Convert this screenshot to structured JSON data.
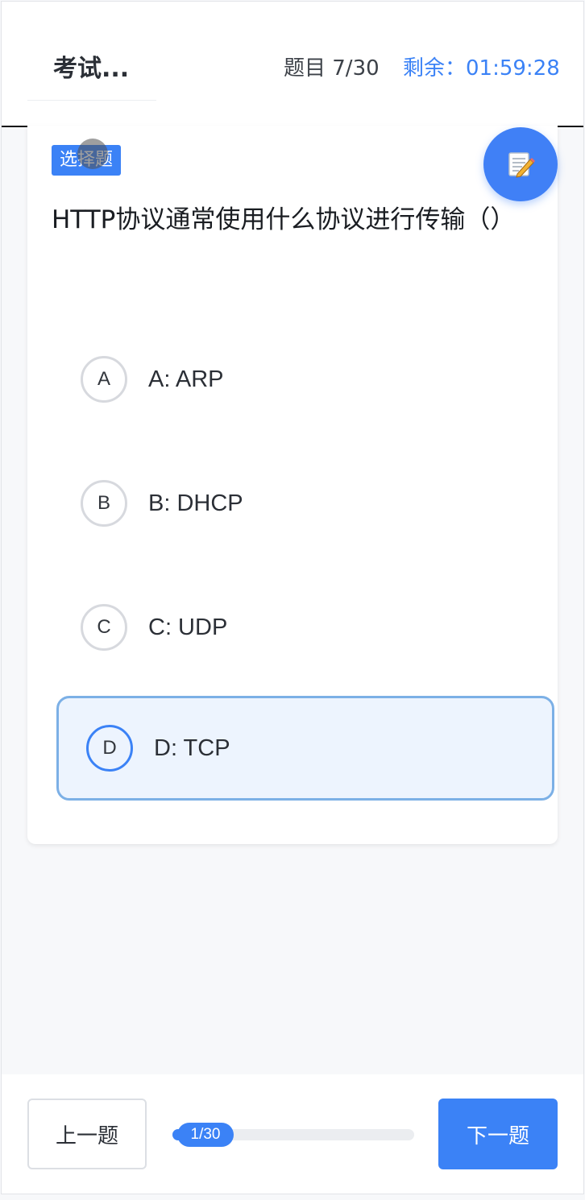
{
  "header": {
    "title": "考试...",
    "progress_text": "题目 7/30",
    "timer_text": "剩余：01:59:28"
  },
  "question": {
    "type_badge": "选择题",
    "text": "HTTP协议通常使用什么协议进行传输（）",
    "options": [
      {
        "letter": "A",
        "label": "A: ARP",
        "selected": false
      },
      {
        "letter": "B",
        "label": "B: DHCP",
        "selected": false
      },
      {
        "letter": "C",
        "label": "C: UDP",
        "selected": false
      },
      {
        "letter": "D",
        "label": "D: TCP",
        "selected": true
      }
    ]
  },
  "fab": {
    "icon": "notepad-pencil-icon"
  },
  "footer": {
    "prev_label": "上一题",
    "next_label": "下一题",
    "progress_pill": "1/30",
    "progress_fraction": 0.0333
  },
  "colors": {
    "accent": "#3b82f6",
    "selected_bg": "#edf4fe",
    "selected_border": "#7cb0e6"
  }
}
